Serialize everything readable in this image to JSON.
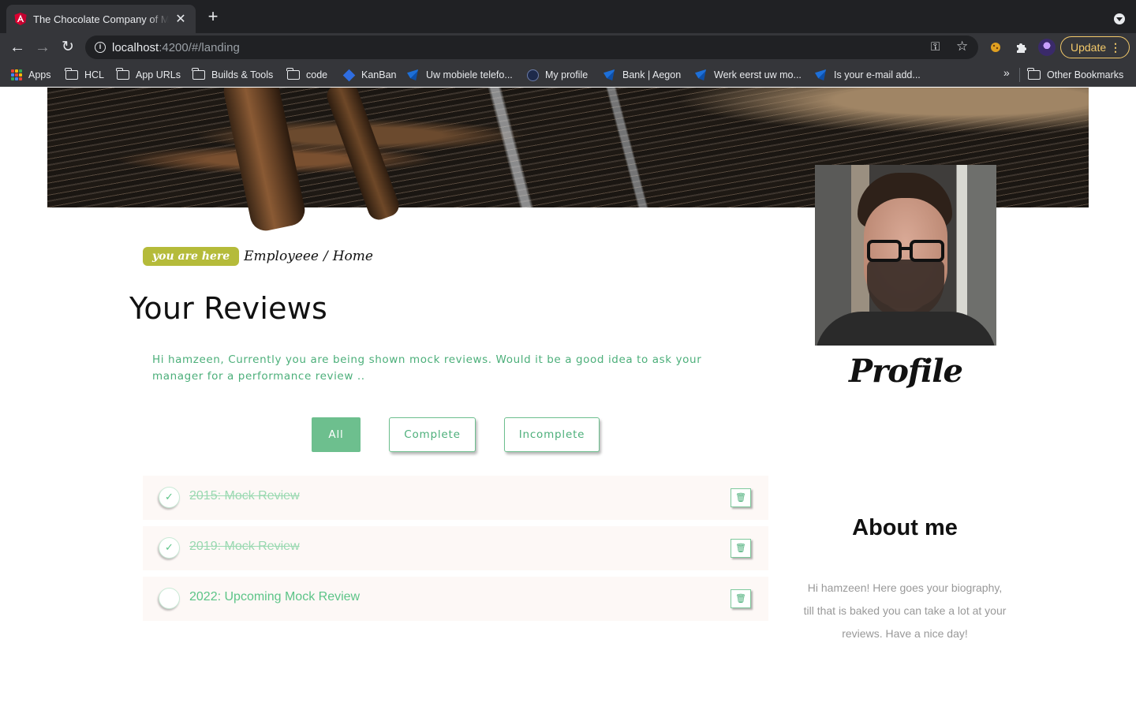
{
  "browser": {
    "tab_title": "The Chocolate Company of Ma",
    "url_host": "localhost",
    "url_path": ":4200/#/landing",
    "update_label": "Update",
    "bookmarks": [
      {
        "label": "Apps",
        "icon": "apps-grid-icon"
      },
      {
        "label": "HCL",
        "icon": "folder-icon"
      },
      {
        "label": "App URLs",
        "icon": "folder-icon"
      },
      {
        "label": "Builds & Tools",
        "icon": "folder-icon"
      },
      {
        "label": "code",
        "icon": "folder-icon"
      },
      {
        "label": "KanBan",
        "icon": "diamond-icon"
      },
      {
        "label": "Uw mobiele telefo...",
        "icon": "bird-icon"
      },
      {
        "label": "My profile",
        "icon": "linkedin-icon"
      },
      {
        "label": "Bank | Aegon",
        "icon": "bird-icon"
      },
      {
        "label": "Werk eerst uw mo...",
        "icon": "bird-icon"
      },
      {
        "label": "Is your e-mail add...",
        "icon": "bird-icon"
      }
    ],
    "more_bookmarks": "»",
    "other_bookmarks": "Other Bookmarks"
  },
  "breadcrumb": {
    "badge": "you are here",
    "section": "Employeee",
    "separator": "/",
    "page": "Home"
  },
  "main": {
    "title": "Your Reviews",
    "intro": "Hi hamzeen, Currently you are being shown mock reviews. Would it be a good idea to ask your manager for a performance review ..",
    "filters": [
      {
        "label": "All",
        "active": true
      },
      {
        "label": "Complete",
        "active": false
      },
      {
        "label": "Incomplete",
        "active": false
      }
    ],
    "reviews": [
      {
        "label": "2015: Mock Review",
        "completed": true
      },
      {
        "label": "2019: Mock Review",
        "completed": true
      },
      {
        "label": "2022: Upcoming Mock Review",
        "completed": false
      }
    ]
  },
  "sidebar": {
    "profile_title": "Profile",
    "about_title": "About me",
    "about_text": "Hi hamzeen! Here goes your biography, till that is baked you can take a lot at your reviews. Have a nice day!"
  },
  "colors": {
    "accent_green": "#6dbf8e",
    "badge_olive": "#b5bb3a",
    "browser_dark": "#202124"
  }
}
